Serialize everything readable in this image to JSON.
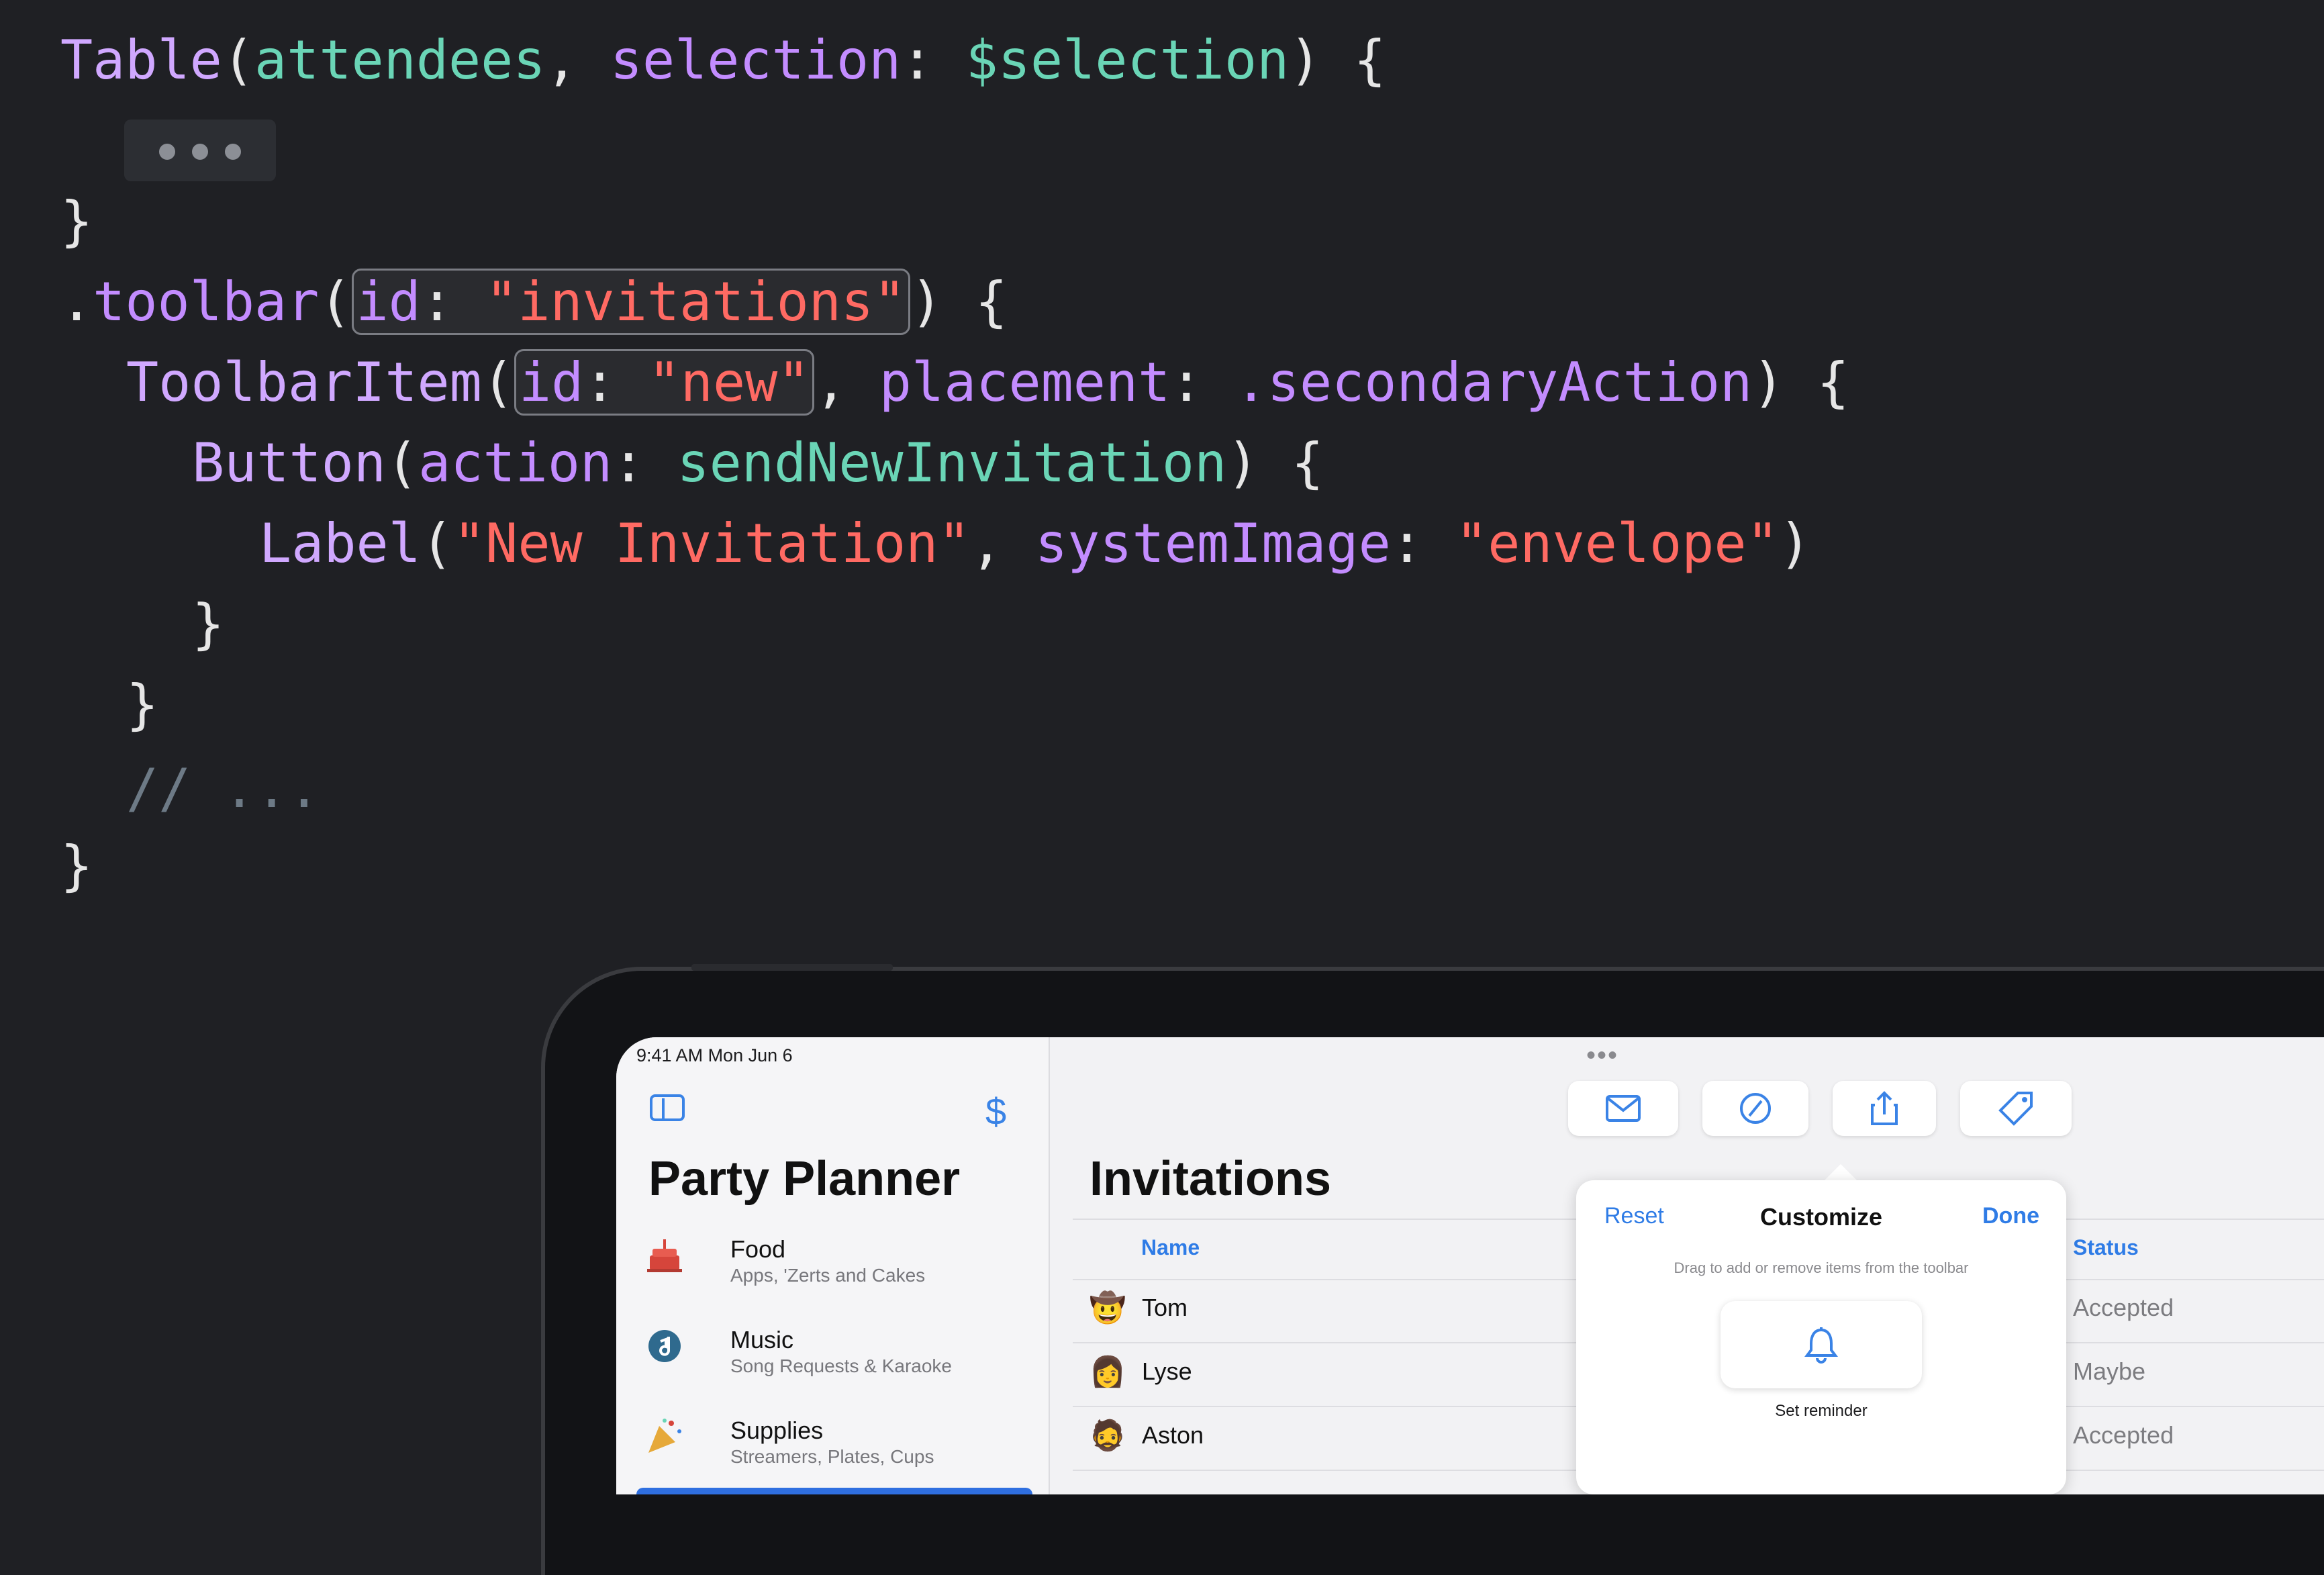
{
  "code": {
    "line1": {
      "type": "Table",
      "p1": "(",
      "arg1": "attendees",
      "sep": ", ",
      "lbl": "selection",
      "colon": ": ",
      "arg2": "$selection",
      "end": ") {"
    },
    "line3": "}",
    "line4": {
      "dot": ".",
      "fn": "toolbar",
      "open": "(",
      "idlbl": "id",
      "colon": ": ",
      "idval": "\"invitations\"",
      "end": ") {"
    },
    "line5": {
      "type": "ToolbarItem",
      "open": "(",
      "idlbl": "id",
      "colon": ": ",
      "idval": "\"new\"",
      "sep": ", ",
      "plbl": "placement",
      "colon2": ": ",
      "pval": ".secondaryAction",
      "end": ") {"
    },
    "line6": {
      "type": "Button",
      "open": "(",
      "albl": "action",
      "colon": ": ",
      "aval": "sendNewInvitation",
      "end": ") {"
    },
    "line7": {
      "type": "Label",
      "open": "(",
      "str": "\"New Invitation\"",
      "sep": ", ",
      "slbl": "systemImage",
      "colon": ": ",
      "sval": "\"envelope\"",
      "end": ")"
    },
    "line8": "}",
    "line9": "}",
    "line10": "// ...",
    "line11": "}"
  },
  "device": {
    "status": "9:41 AM   Mon Jun 6",
    "sidebar": {
      "dollar_icon": "$",
      "title": "Party Planner",
      "items": [
        {
          "icon": "cake-icon",
          "title": "Food",
          "subtitle": "Apps, 'Zerts and Cakes"
        },
        {
          "icon": "music-icon",
          "title": "Music",
          "subtitle": "Song Requests & Karaoke"
        },
        {
          "icon": "party-popper-icon",
          "title": "Supplies",
          "subtitle": "Streamers, Plates, Cups"
        }
      ]
    },
    "main": {
      "title": "Invitations",
      "more": "•••",
      "columns": {
        "name": "Name",
        "status": "Status"
      },
      "rows": [
        {
          "name": "Tom",
          "status": "Accepted",
          "avatar": "🤠"
        },
        {
          "name": "Lyse",
          "status": "Maybe",
          "avatar": "👩"
        },
        {
          "name": "Aston",
          "status": "Accepted",
          "avatar": "🧔"
        }
      ]
    },
    "toolbar_icons": [
      "envelope-icon",
      "slash-circle-icon",
      "share-icon",
      "tag-icon"
    ],
    "popover": {
      "reset": "Reset",
      "title": "Customize",
      "done": "Done",
      "hint": "Drag to add or remove items from the toolbar",
      "reminder_label": "Set reminder"
    }
  },
  "colors": {
    "accent": "#2f7ce6",
    "string": "#ff6a63",
    "type": "#d0a8ff",
    "variable": "#6ad5b6"
  }
}
